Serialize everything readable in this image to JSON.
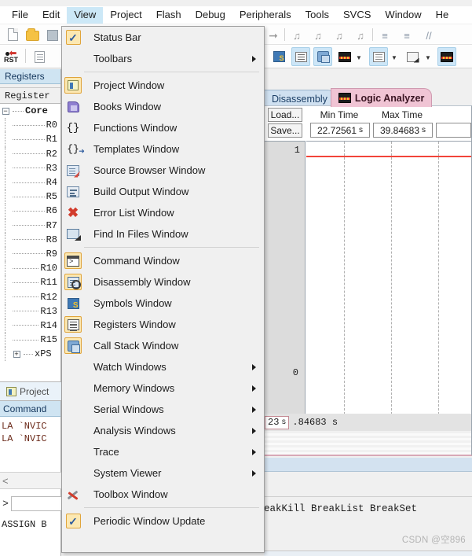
{
  "menubar": {
    "items": [
      {
        "label": "File",
        "active": false
      },
      {
        "label": "Edit",
        "active": false
      },
      {
        "label": "View",
        "active": true
      },
      {
        "label": "Project",
        "active": false
      },
      {
        "label": "Flash",
        "active": false
      },
      {
        "label": "Debug",
        "active": false
      },
      {
        "label": "Peripherals",
        "active": false
      },
      {
        "label": "Tools",
        "active": false
      },
      {
        "label": "SVCS",
        "active": false
      },
      {
        "label": "Window",
        "active": false
      },
      {
        "label": "He",
        "active": false
      }
    ]
  },
  "toolbar": {
    "reset_label": "RST",
    "icons": [
      "new-file-icon",
      "open-folder-icon",
      "save-icon",
      "reset-icon",
      "insert-file-icon",
      "step-icon",
      "bookmark-icon",
      "bookmark-prev-icon",
      "bookmark-next-icon",
      "bookmark-clear-icon",
      "indent-icon",
      "outdent-icon",
      "comment-icon"
    ],
    "debug_toggles": [
      {
        "name": "symbols-window-toggle",
        "active": false
      },
      {
        "name": "registers-window-toggle",
        "active": true
      },
      {
        "name": "call-stack-window-toggle",
        "active": true
      },
      {
        "name": "trace-window-toggle",
        "active": false
      },
      {
        "name": "memory-window-toggle",
        "active": true
      },
      {
        "name": "serial-window-toggle",
        "active": false
      },
      {
        "name": "logic-analyzer-toggle",
        "active": true
      }
    ]
  },
  "view_menu": {
    "items": [
      {
        "kind": "check",
        "label": "Status Bar",
        "checked": true,
        "icon": "checkmark-icon",
        "submenu": false
      },
      {
        "kind": "sub",
        "label": "Toolbars",
        "checked": false,
        "icon": "",
        "submenu": true
      },
      {
        "kind": "sep"
      },
      {
        "kind": "icon",
        "label": "Project Window",
        "pressed": true,
        "icon": "project-window-icon",
        "submenu": false
      },
      {
        "kind": "icon",
        "label": "Books Window",
        "pressed": false,
        "icon": "books-window-icon",
        "submenu": false
      },
      {
        "kind": "icon",
        "label": "Functions Window",
        "pressed": false,
        "icon": "functions-braces-icon",
        "submenu": false
      },
      {
        "kind": "icon",
        "label": "Templates Window",
        "pressed": false,
        "icon": "templates-braces-arrow-icon",
        "submenu": false
      },
      {
        "kind": "icon",
        "label": "Source Browser Window",
        "pressed": false,
        "icon": "source-browser-icon",
        "submenu": false
      },
      {
        "kind": "icon",
        "label": "Build Output Window",
        "pressed": false,
        "icon": "build-output-icon",
        "submenu": false
      },
      {
        "kind": "icon",
        "label": "Error List Window",
        "pressed": false,
        "icon": "error-list-x-icon",
        "submenu": false
      },
      {
        "kind": "icon",
        "label": "Find In Files Window",
        "pressed": false,
        "icon": "find-in-files-icon",
        "submenu": false
      },
      {
        "kind": "sep"
      },
      {
        "kind": "icon",
        "label": "Command Window",
        "pressed": true,
        "icon": "command-window-icon",
        "submenu": false
      },
      {
        "kind": "icon",
        "label": "Disassembly Window",
        "pressed": true,
        "icon": "disassembly-window-icon",
        "submenu": false
      },
      {
        "kind": "icon",
        "label": "Symbols Window",
        "pressed": false,
        "icon": "symbols-window-icon",
        "submenu": false
      },
      {
        "kind": "icon",
        "label": "Registers Window",
        "pressed": true,
        "icon": "registers-window-icon",
        "submenu": false
      },
      {
        "kind": "icon",
        "label": "Call Stack Window",
        "pressed": true,
        "icon": "call-stack-window-icon",
        "submenu": false
      },
      {
        "kind": "sub",
        "label": "Watch Windows",
        "submenu": true
      },
      {
        "kind": "sub",
        "label": "Memory Windows",
        "submenu": true
      },
      {
        "kind": "sub",
        "label": "Serial Windows",
        "submenu": true
      },
      {
        "kind": "sub",
        "label": "Analysis Windows",
        "submenu": true
      },
      {
        "kind": "sub",
        "label": "Trace",
        "submenu": true
      },
      {
        "kind": "sub",
        "label": "System Viewer",
        "submenu": true
      },
      {
        "kind": "icon",
        "label": "Toolbox Window",
        "pressed": false,
        "icon": "toolbox-window-icon",
        "submenu": false
      },
      {
        "kind": "sep"
      },
      {
        "kind": "check",
        "label": "Periodic Window Update",
        "checked": true,
        "icon": "checkmark-icon",
        "submenu": false
      }
    ]
  },
  "registers_panel": {
    "tab_label": "Registers",
    "column_header": "Register",
    "group": {
      "label": "Core",
      "expander": "−"
    },
    "rows": [
      "R0",
      "R1",
      "R2",
      "R3",
      "R4",
      "R5",
      "R6",
      "R7",
      "R8",
      "R9",
      "R10",
      "R11",
      "R12",
      "R13",
      "R14",
      "R15"
    ],
    "xpsr": {
      "label": "xPS",
      "expander": "+"
    },
    "bottom_tab": {
      "label": "Project",
      "icon": "project-window-icon"
    }
  },
  "command_window": {
    "title": "Command",
    "lines": [
      "LA `NVIC",
      "LA `NVIC"
    ],
    "scroll_glyph": "<",
    "prompt": ">",
    "input_value": "",
    "assign_line": "ASSIGN B"
  },
  "document_tabs": [
    {
      "label": "Disassembly",
      "active": false,
      "icon": ""
    },
    {
      "label": "Logic Analyzer",
      "active": true,
      "icon": "logic-analyzer-icon"
    }
  ],
  "logic_analyzer": {
    "load_label": "Load...",
    "save_label": "Save...",
    "min_time": {
      "header": "Min Time",
      "value": "22.72561",
      "unit": "s"
    },
    "max_time": {
      "header": "Max Time",
      "value": "39.84683",
      "unit": "s"
    },
    "scale_top": "1",
    "scale_bottom": "0",
    "trace_color": "#f2443a",
    "timebar_left": {
      "value": "23",
      "unit": "s"
    },
    "timebar_right": ".84683  s"
  },
  "command_echo": {
    "text": "eakKill BreakList BreakSet"
  },
  "watermark": {
    "text": "CSDN @空896"
  },
  "colors": {
    "menu_highlight": "#cce8f7",
    "checkbox_fill": "#fce8b2",
    "checkbox_border": "#e0a53c",
    "active_tab": "#f0c4d4",
    "inactive_tab": "#cfe0f0",
    "trace": "#f2443a",
    "panel_header": "#cfe4f2"
  }
}
